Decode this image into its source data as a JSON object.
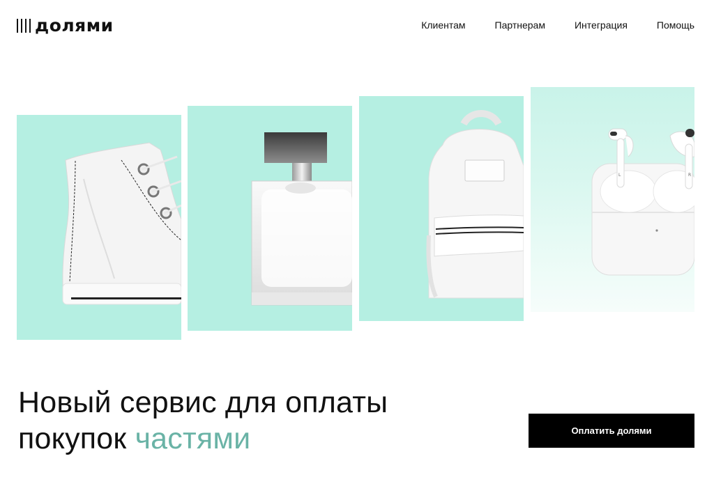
{
  "header": {
    "logo_text": "долями",
    "nav": [
      "Клиентам",
      "Партнерам",
      "Интеграция",
      "Помощь"
    ]
  },
  "products": [
    {
      "icon": "sneaker-icon"
    },
    {
      "icon": "perfume-bottle-icon"
    },
    {
      "icon": "backpack-icon"
    },
    {
      "icon": "earbuds-case-icon"
    }
  ],
  "hero": {
    "line1": "Новый сервис для оплаты",
    "line2_prefix": "покупок ",
    "line2_accent": "частями"
  },
  "cta": {
    "label": "Оплатить долями"
  },
  "colors": {
    "card_mint": "#b5efe2",
    "accent_text": "#6ab3a6",
    "button_bg": "#000000",
    "button_text": "#ffffff"
  }
}
